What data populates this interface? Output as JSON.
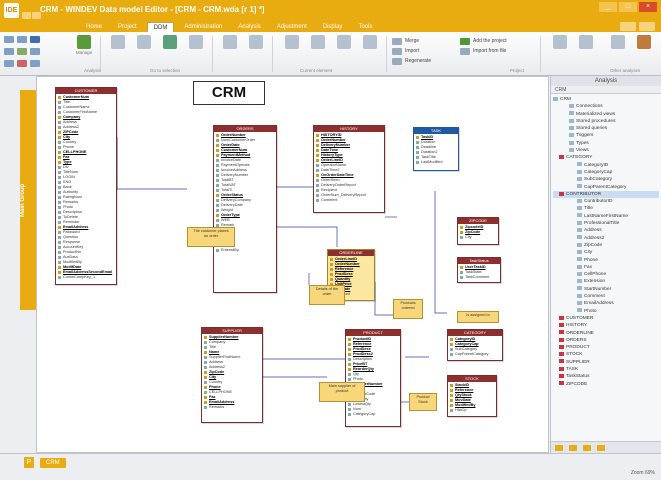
{
  "app": {
    "logo": "IDE",
    "title": "CRM - WINDEV   Data model Editor - [CRM - CRM.wda [r 1] *]"
  },
  "tabs": [
    "Home",
    "Project",
    "DDM",
    "Administration",
    "Analysis",
    "Adjustment",
    "Display",
    "Tools"
  ],
  "active_tab": "DDM",
  "ribbon": {
    "manage_label": "Manage",
    "add_project": "Add the project",
    "import_file": "Import from file",
    "merge": "Merge",
    "import_struct": "Import",
    "regenerate": "Regenerate",
    "groups": [
      "Analysis",
      "Go to selection",
      "Current element",
      "Project",
      "Other analyses"
    ]
  },
  "left_panel": {
    "main_group": "Main Group"
  },
  "canvas": {
    "title": "CRM",
    "entities": [
      {
        "id": "customer",
        "name": "CUSTOMER",
        "style": "red",
        "rows": [
          "CustomerNum",
          "Title",
          "CustomerName",
          "CustomerFirstName",
          "Company",
          "Address",
          "Address2",
          "ZIPCode",
          "City",
          "Country",
          "Phone",
          "CELLPHONE",
          "Fax",
          "Type",
          "Dlv",
          "TitleNum",
          "LOGIN",
          "KNO",
          "Bank",
          "Authority",
          "RatingNum",
          "Remarks",
          "Photo",
          "Description",
          "ToDelete",
          "Reminder",
          "EmailAddress",
          "Password",
          "Question",
          "Response",
          "AccountKey",
          "ProductNo",
          "AuxData",
          "ModifiedBy",
          "ModifDate",
          "EmailAddressSecondEmail",
          "CommCompKey_1"
        ],
        "keys": [
          0,
          4,
          7,
          8,
          11,
          12,
          13,
          26,
          34,
          35
        ]
      },
      {
        "id": "orders",
        "name": "ORDERS",
        "style": "red",
        "rows": [
          "OrderNumber",
          "NumCustomerOrder",
          "OrderDate",
          "CustomerNum",
          "PaymentMethod",
          "InvoiceDate",
          "PaymentOperate",
          "InvoiceAddress",
          "DeliveryNumber",
          "TotalBT",
          "TotalVAT",
          "TotalTI",
          "OrderStatus",
          "DeliveryCompany",
          "DeliveryDate",
          "Weight",
          "OrderType",
          "WEB",
          "Remark",
          "SUM",
          "SUM2",
          "Origin",
          "Status",
          "EnteredBy"
        ],
        "keys": [
          0,
          2,
          3,
          4,
          12,
          16
        ]
      },
      {
        "id": "history",
        "name": "HISTORY",
        "style": "red",
        "rows": [
          "HISTORYID",
          "OrderNumber",
          "DeliveryNumber",
          "DateTime",
          "HistoryType",
          "OrderLineID",
          "OperatorName",
          "DateTime2",
          "OnOrderDateTime",
          "OrderSeen",
          "DeliveryOrderReport",
          "Recipient",
          "OrderNum_DeliveryReport",
          "Comment"
        ],
        "keys": [
          0,
          1,
          2,
          3,
          4,
          5,
          8
        ]
      },
      {
        "id": "task",
        "name": "TASK",
        "style": "blue",
        "rows": [
          "TaskID",
          "Duration",
          "Deadline",
          "Duration2",
          "TaskTitle",
          "LastModified"
        ],
        "keys": [
          0
        ]
      },
      {
        "id": "orderline",
        "name": "ORDERLINE",
        "style": "yellow",
        "rows": [
          "OrderLineID",
          "OrderNumber",
          "Reference",
          "ProdDesc",
          "Quantity",
          "UnitPrice",
          "VATRate",
          "Discount"
        ],
        "keys": [
          0,
          1,
          2,
          3,
          4,
          5,
          6
        ]
      },
      {
        "id": "zipcode",
        "name": "ZIPCODE",
        "style": "red",
        "rows": [
          "ZipcodeID",
          "ZipCode",
          "City"
        ],
        "keys": [
          0,
          1
        ]
      },
      {
        "id": "userparam",
        "name": "TaskStatus",
        "style": "red",
        "rows": [
          "UserTaskID",
          "TaskState",
          "TaskComment"
        ],
        "keys": [
          0
        ]
      },
      {
        "id": "supplier",
        "name": "SUPPLIER",
        "style": "red",
        "rows": [
          "SupplierNumber",
          "Company",
          "Title",
          "Name",
          "SupplierFirstName",
          "Address",
          "Address2",
          "ZipCode",
          "City",
          "Country",
          "Phone",
          "CELLPHONE",
          "Fax",
          "EmailAddress",
          "Remarks"
        ],
        "keys": [
          0,
          3,
          7,
          8,
          10,
          12,
          13
        ]
      },
      {
        "id": "product",
        "name": "PRODUCT",
        "style": "red",
        "rows": [
          "ProductID",
          "Reference",
          "ProdDesc",
          "ProdDesc2",
          "Description",
          "PriceBT",
          "ReorderQty",
          "Qty",
          "Photo",
          "SupplierNumber",
          "Type",
          "ProductCode",
          "StockQty",
          "LowestQty",
          "Num",
          "CategoryCap"
        ],
        "keys": [
          0,
          1,
          2,
          3,
          5,
          6,
          9
        ]
      },
      {
        "id": "category",
        "name": "CATEGORY",
        "style": "red",
        "rows": [
          "CategoryID",
          "CategoryCap",
          "SubCategory",
          "CapParentCategory"
        ],
        "keys": [
          0,
          1
        ]
      },
      {
        "id": "stock",
        "name": "STOCK",
        "style": "red",
        "rows": [
          "StockID",
          "Reference",
          "QtyStock",
          "MovDate",
          "ModifiedBy",
          "HistOp"
        ],
        "keys": [
          0,
          1,
          2,
          3,
          4
        ]
      }
    ],
    "notes": [
      {
        "id": "n1",
        "text": "The customer places an order"
      },
      {
        "id": "n2",
        "text": "Details of the order"
      },
      {
        "id": "n3",
        "text": "Products ordered"
      },
      {
        "id": "n4",
        "text": "Is assigned to"
      },
      {
        "id": "n5",
        "text": "Main supplier of product"
      },
      {
        "id": "n6",
        "text": "Product Stock"
      }
    ]
  },
  "right_panel": {
    "title": "Analysis",
    "tab": "CRM",
    "tree": [
      {
        "label": "CRM",
        "level": 0
      },
      {
        "label": "Connections",
        "level": 2
      },
      {
        "label": "Materialized views",
        "level": 2
      },
      {
        "label": "Stored procedures",
        "level": 2
      },
      {
        "label": "Stored queries",
        "level": 2
      },
      {
        "label": "Triggers",
        "level": 2
      },
      {
        "label": "Types",
        "level": 2
      },
      {
        "label": "Views",
        "level": 2
      },
      {
        "label": "CATEGORY",
        "level": 1,
        "group": true
      },
      {
        "label": "CategoryID",
        "level": 3
      },
      {
        "label": "CategoryCap",
        "level": 3
      },
      {
        "label": "SubCategory",
        "level": 3
      },
      {
        "label": "CapParentCategory",
        "level": 3
      },
      {
        "label": "CONTRIBUTOR",
        "level": 1,
        "group": true,
        "selected": true
      },
      {
        "label": "ContributorID",
        "level": 3
      },
      {
        "label": "Title",
        "level": 3
      },
      {
        "label": "LastNameFirstName",
        "level": 3
      },
      {
        "label": "ProfessionalTitle",
        "level": 3
      },
      {
        "label": "Address",
        "level": 3
      },
      {
        "label": "Address2",
        "level": 3
      },
      {
        "label": "ZipCode",
        "level": 3
      },
      {
        "label": "City",
        "level": 3
      },
      {
        "label": "Phone",
        "level": 3
      },
      {
        "label": "Fax",
        "level": 3
      },
      {
        "label": "CellPhone",
        "level": 3
      },
      {
        "label": "Extension",
        "level": 3
      },
      {
        "label": "StartNumber",
        "level": 3
      },
      {
        "label": "Comment",
        "level": 3
      },
      {
        "label": "EmailAddress",
        "level": 3
      },
      {
        "label": "Photo",
        "level": 3
      },
      {
        "label": "CUSTOMER",
        "level": 1,
        "group": true
      },
      {
        "label": "HISTORY",
        "level": 1,
        "group": true
      },
      {
        "label": "ORDERLINE",
        "level": 1,
        "group": true
      },
      {
        "label": "ORDERS",
        "level": 1,
        "group": true
      },
      {
        "label": "PRODUCT",
        "level": 1,
        "group": true
      },
      {
        "label": "STOCK",
        "level": 1,
        "group": true
      },
      {
        "label": "SUPPLIER",
        "level": 1,
        "group": true
      },
      {
        "label": "TASK",
        "level": 1,
        "group": true
      },
      {
        "label": "TaskStatus",
        "level": 1,
        "group": true
      },
      {
        "label": "ZIPCODE",
        "level": 1,
        "group": true
      }
    ]
  },
  "status": {
    "doc_tab": "CRM",
    "zoom": "Zoom 69%"
  },
  "colors": {
    "accent": "#e8ab10",
    "entity_header": "#8e2f2f",
    "task_header": "#1f5aa0",
    "link": "#2c43a8"
  }
}
